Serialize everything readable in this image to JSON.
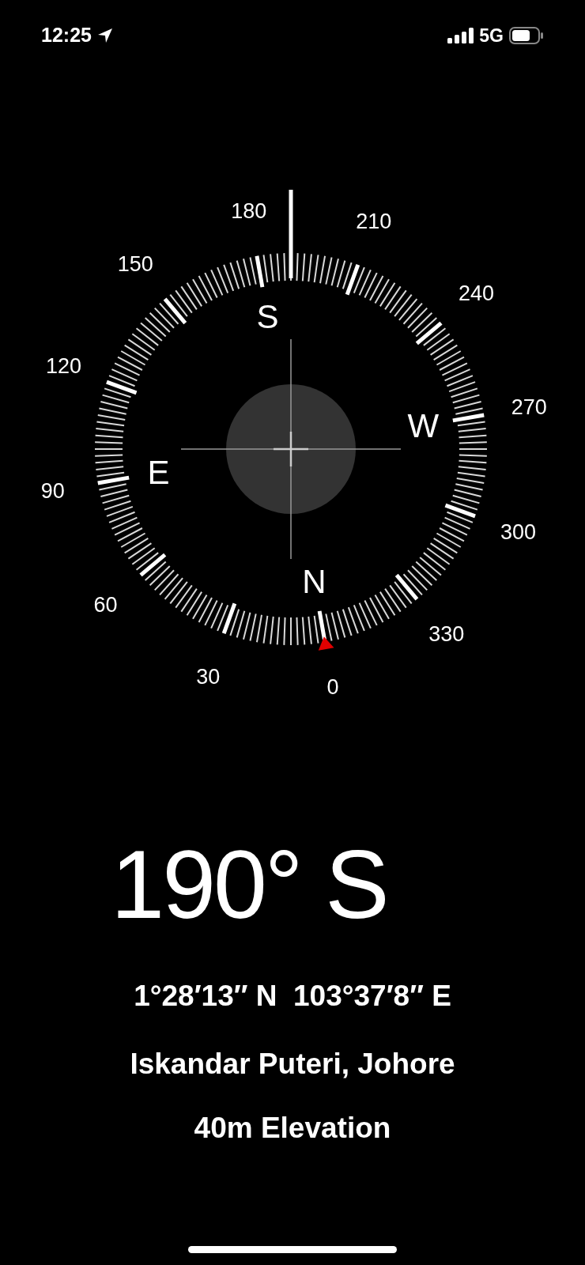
{
  "status_bar": {
    "time": "12:25",
    "network": "5G"
  },
  "compass": {
    "degree_labels": [
      "0",
      "30",
      "60",
      "90",
      "120",
      "150",
      "180",
      "210",
      "240",
      "270",
      "300",
      "330"
    ],
    "cardinals": [
      "N",
      "E",
      "S",
      "W"
    ]
  },
  "heading": "190° S",
  "coordinates": "1°28′13″ N  103°37′8″ E",
  "location": "Iskandar Puteri, Johore",
  "elevation": "40m Elevation"
}
